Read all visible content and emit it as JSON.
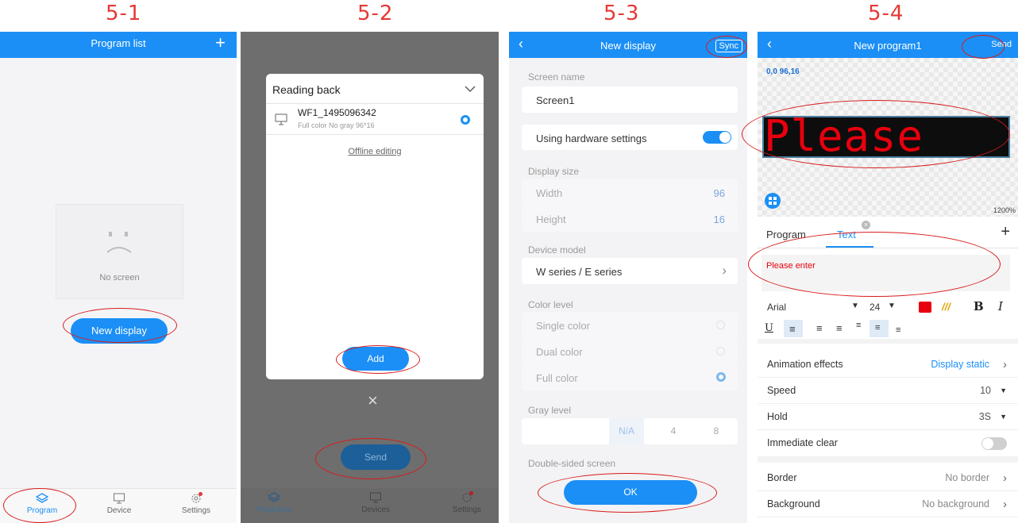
{
  "steps": [
    "5-1",
    "5-2",
    "5-3",
    "5-4"
  ],
  "panel1": {
    "title": "Program list",
    "add_icon": "plus-icon",
    "empty_text": "No screen",
    "new_display_label": "New display",
    "nav": [
      {
        "label": "Program",
        "icon": "layers-icon"
      },
      {
        "label": "Device",
        "icon": "monitor-icon"
      },
      {
        "label": "Settings",
        "icon": "gear-icon"
      }
    ]
  },
  "panel2": {
    "dialog_title": "Reading back",
    "device_name": "WF1_1495096342",
    "device_info": "Full color  No gray  96*16",
    "offline_label": "Offline editing",
    "add_label": "Add",
    "send_label": "Send",
    "nav": [
      {
        "label": "Programs",
        "icon": "layers-icon"
      },
      {
        "label": "Devices",
        "icon": "monitor-icon"
      },
      {
        "label": "Settings",
        "icon": "gear-icon"
      }
    ]
  },
  "panel3": {
    "title": "New display",
    "sync_label": "Sync",
    "screen_name_label": "Screen name",
    "screen_name_value": "Screen1",
    "hw_label": "Using hardware settings",
    "hw_on": true,
    "display_size_label": "Display size",
    "width_label": "Width",
    "width_value": "96",
    "height_label": "Height",
    "height_value": "16",
    "device_model_label": "Device model",
    "device_model_value": "W series / E series",
    "color_level_label": "Color level",
    "color_options": [
      "Single color",
      "Dual color",
      "Full color"
    ],
    "color_selected": "Full color",
    "gray_level_label": "Gray level",
    "gray_options": [
      "N/A",
      "4",
      "8"
    ],
    "gray_selected": "N/A",
    "double_sided_label": "Double-sided screen",
    "ok_label": "OK"
  },
  "panel4": {
    "title": "New program1",
    "send_label": "Send",
    "coords_text": "0,0 96,16",
    "led_text": "Please",
    "zoom_text": "1200%",
    "tabs": [
      "Program",
      "Text"
    ],
    "active_tab": "Text",
    "text_value": "Please enter",
    "font": "Arial",
    "font_size": "24",
    "text_color": "#e8000e",
    "rows": [
      {
        "label": "Animation effects",
        "value": "Display static"
      },
      {
        "label": "Speed",
        "value": "10"
      },
      {
        "label": "Hold",
        "value": "3S"
      },
      {
        "label": "Immediate clear",
        "value": ""
      },
      {
        "label": "Border",
        "value": "No border"
      },
      {
        "label": "Background",
        "value": "No background"
      }
    ]
  },
  "colors": {
    "accent": "#1b8ff5",
    "annotation": "#d81b1b",
    "led": "#e8000e"
  }
}
